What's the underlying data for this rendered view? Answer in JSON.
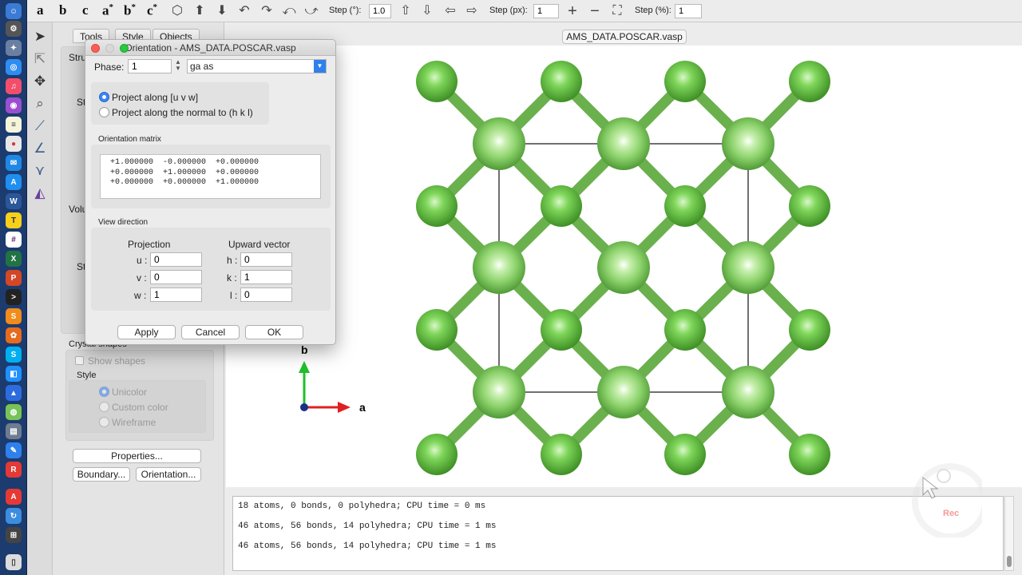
{
  "toolbar": {
    "letters": [
      "a",
      "b",
      "c",
      "a",
      "b",
      "c"
    ],
    "star": "*",
    "step_deg_label": "Step (°):",
    "step_deg_value": "1.0",
    "step_px_label": "Step (px):",
    "step_px_value": "1",
    "step_pct_label": "Step (%):",
    "step_pct_value": "1"
  },
  "left_panel": {
    "tabs": [
      "Tools",
      "Style",
      "Objects"
    ],
    "crystal_shapes_title": "Crystal shapes",
    "show_shapes": "Show shapes",
    "style_label": "Style",
    "style_options": [
      "Unicolor",
      "Custom color",
      "Wireframe"
    ],
    "properties_btn": "Properties...",
    "boundary_btn": "Boundary...",
    "orientation_btn": "Orientation...",
    "partial_labels": [
      "Stru",
      "St",
      "Volu",
      "St"
    ]
  },
  "document": {
    "tab_title": "AMS_DATA.POSCAR.vasp"
  },
  "axes": {
    "b_label": "b",
    "a_label": "a"
  },
  "log": {
    "lines": [
      "18 atoms, 0 bonds, 0 polyhedra; CPU time = 0 ms",
      "46 atoms, 56 bonds, 14 polyhedra; CPU time = 1 ms",
      "46 atoms, 56 bonds, 14 polyhedra; CPU time = 1 ms"
    ]
  },
  "dialog": {
    "title": "Orientation - AMS_DATA.POSCAR.vasp",
    "phase_label": "Phase:",
    "phase_value": "1",
    "phase_name": "ga as",
    "radio_project_uvw": "Project along [u v w]",
    "radio_project_hkl": "Project along the normal to (h k l)",
    "matrix_title": "Orientation matrix",
    "matrix_rows": [
      "+1.000000  -0.000000  +0.000000",
      "+0.000000  +1.000000  +0.000000",
      "+0.000000  +0.000000  +1.000000"
    ],
    "view_direction_title": "View direction",
    "projection_header": "Projection",
    "upward_header": "Upward vector",
    "u_label": "u :",
    "u_value": "0",
    "v_label": "v :",
    "v_value": "0",
    "w_label": "w :",
    "w_value": "1",
    "h_label": "h :",
    "h_value": "0",
    "k_label": "k :",
    "k_value": "1",
    "l_label": "l :",
    "l_value": "0",
    "apply_btn": "Apply",
    "cancel_btn": "Cancel",
    "ok_btn": "OK"
  },
  "overlay": {
    "rec_label": "Rec"
  },
  "colors": {
    "atom": "#6fcf4a",
    "bond": "#5aa83a",
    "accent": "#3b82f6"
  }
}
